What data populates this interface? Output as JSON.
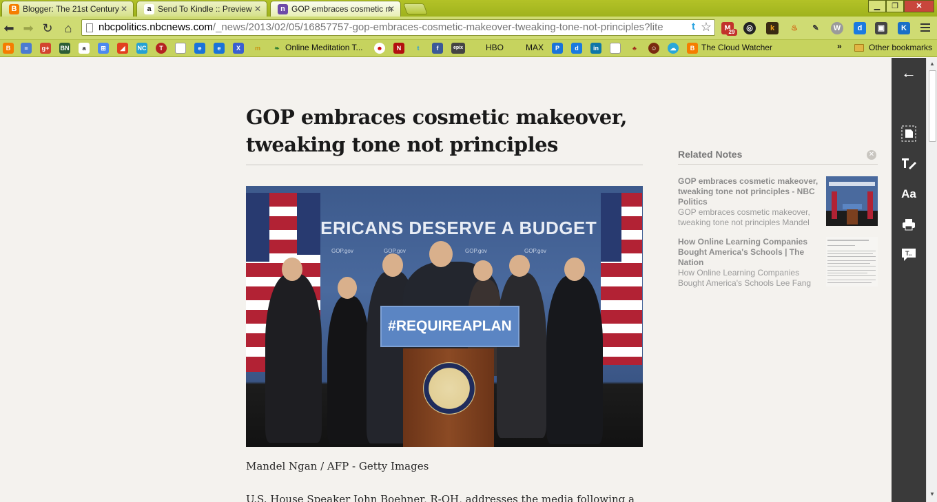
{
  "tabs": [
    {
      "label": "Blogger: The 21st Century",
      "favicon": "B",
      "color": "#f57d00"
    },
    {
      "label": "Send To Kindle :: Preview",
      "favicon": "a",
      "color": "#222222"
    },
    {
      "label": "GOP embraces cosmetic m",
      "favicon": "n",
      "color": "#6d4aa8"
    }
  ],
  "window": {
    "minimize": "▁",
    "maximize": "❐",
    "close": "✕"
  },
  "address": {
    "host": "nbcpolitics.nbcnews.com",
    "path": "/_news/2013/02/05/16857757-gop-embraces-cosmetic-makeover-tweaking-tone-not-principles?lite"
  },
  "extensions": {
    "gmail_count": "29"
  },
  "bookmarks": {
    "online_meditation": "Online Meditation T...",
    "hbo": "HBO",
    "max": "MAX",
    "cloud_watcher": "The Cloud Watcher",
    "other": "Other bookmarks",
    "overflow": "»"
  },
  "article": {
    "headline": "GOP embraces cosmetic makeover, tweaking tone not principles",
    "photo_banner": "AMERICANS DESERVE A BUDGET",
    "photo_sign": "#REQUIREAPLAN",
    "caption": "Mandel Ngan / AFP - Getty Images",
    "body_start": "U.S. House Speaker John Boehner, R-OH, addresses the media following a"
  },
  "related": {
    "title": "Related Notes",
    "notes": [
      {
        "title": "GOP embraces cosmetic makeover, tweaking tone not principles - NBC Politics",
        "snippet": "GOP embraces cosmetic makeover, tweaking tone not principles Mandel"
      },
      {
        "title": "How Online Learning Companies Bought America's Schools | The Nation",
        "snippet": "How Online Learning Companies Bought America's Schools Lee Fang"
      }
    ]
  },
  "sidepanel": {
    "back": "←",
    "font": "Aa"
  }
}
